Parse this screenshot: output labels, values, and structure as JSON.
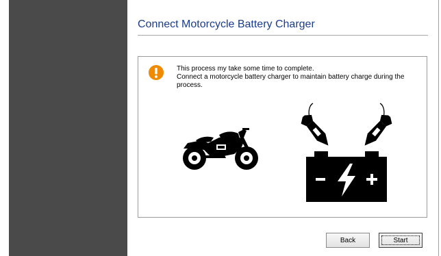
{
  "page": {
    "title": "Connect Motorcycle Battery Charger"
  },
  "message": {
    "line1": "This process my take some time to complete.",
    "line2": "Connect a motorcycle battery charger to maintain battery charge during the process."
  },
  "icons": {
    "warning": "warning-icon",
    "motorcycle": "motorcycle-icon",
    "charger": "battery-charger-icon"
  },
  "buttons": {
    "back_label": "Back",
    "start_label": "Start"
  },
  "colors": {
    "sidebar": "#4a4a4a",
    "title": "#1a3c8c",
    "warning": "#f08a00"
  }
}
